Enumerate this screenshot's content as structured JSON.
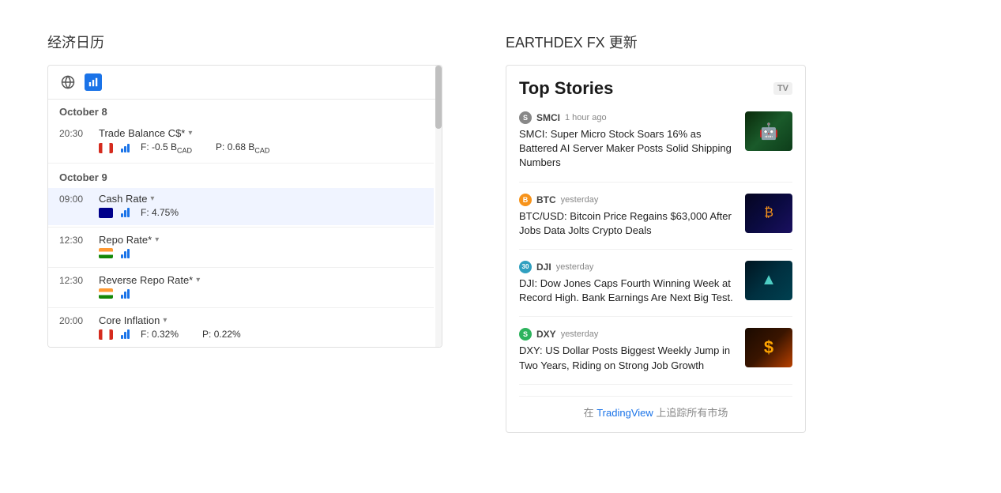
{
  "left": {
    "title": "经济日历",
    "calendar": {
      "dates": [
        {
          "label": "October 8",
          "events": [
            {
              "time": "20:30",
              "name": "Trade Balance C$*",
              "country": "ca",
              "forecast": "F: -0.5 B",
              "forecast_unit": "CAD",
              "previous": "P: 0.68 B",
              "previous_unit": "CAD",
              "highlighted": false
            }
          ]
        },
        {
          "label": "October 9",
          "events": [
            {
              "time": "09:00",
              "name": "Cash Rate",
              "country": "au",
              "forecast": "F: 4.75%",
              "previous": "",
              "highlighted": true
            },
            {
              "time": "12:30",
              "name": "Repo Rate*",
              "country": "in",
              "forecast": "",
              "previous": "",
              "highlighted": false
            },
            {
              "time": "12:30",
              "name": "Reverse Repo Rate*",
              "country": "in",
              "forecast": "",
              "previous": "",
              "highlighted": false
            },
            {
              "time": "20:00",
              "name": "Core Inflation",
              "country": "ca",
              "forecast": "F: 0.32%",
              "previous": "P: 0.22%",
              "highlighted": false
            }
          ]
        }
      ]
    }
  },
  "right": {
    "title": "EARTHDEX FX 更新",
    "news": {
      "heading": "Top Stories",
      "items": [
        {
          "source_label": "SMCI",
          "source_bg": "#888888",
          "source_initial": "S",
          "time": "1 hour ago",
          "headline": "SMCI: Super Micro Stock Soars 16% as Battered AI Server Maker Posts Solid Shipping Numbers",
          "thumb_class": "thumb-green",
          "thumb_icon": "🤖"
        },
        {
          "source_label": "BTC",
          "source_bg": "#f7931a",
          "source_initial": "B",
          "time": "yesterday",
          "headline": "BTC/USD: Bitcoin Price Regains $63,000 After Jobs Data Jolts Crypto Deals",
          "thumb_class": "thumb-blue",
          "thumb_icon": "₿"
        },
        {
          "source_label": "DJI",
          "source_bg": "#30a0c0",
          "source_initial": "30",
          "time": "yesterday",
          "headline": "DJI: Dow Jones Caps Fourth Winning Week at Record High. Bank Earnings Are Next Big Test.",
          "thumb_class": "thumb-teal",
          "thumb_icon": "▲"
        },
        {
          "source_label": "DXY",
          "source_bg": "#2db35d",
          "source_initial": "S",
          "time": "yesterday",
          "headline": "DXY: US Dollar Posts Biggest Weekly Jump in Two Years, Riding on Strong Job Growth",
          "thumb_class": "thumb-orange",
          "thumb_icon": "$"
        }
      ],
      "footer": "在 TradingView 上追踪所有市场",
      "footer_link": "TradingView",
      "tv_badge": "TV"
    }
  }
}
